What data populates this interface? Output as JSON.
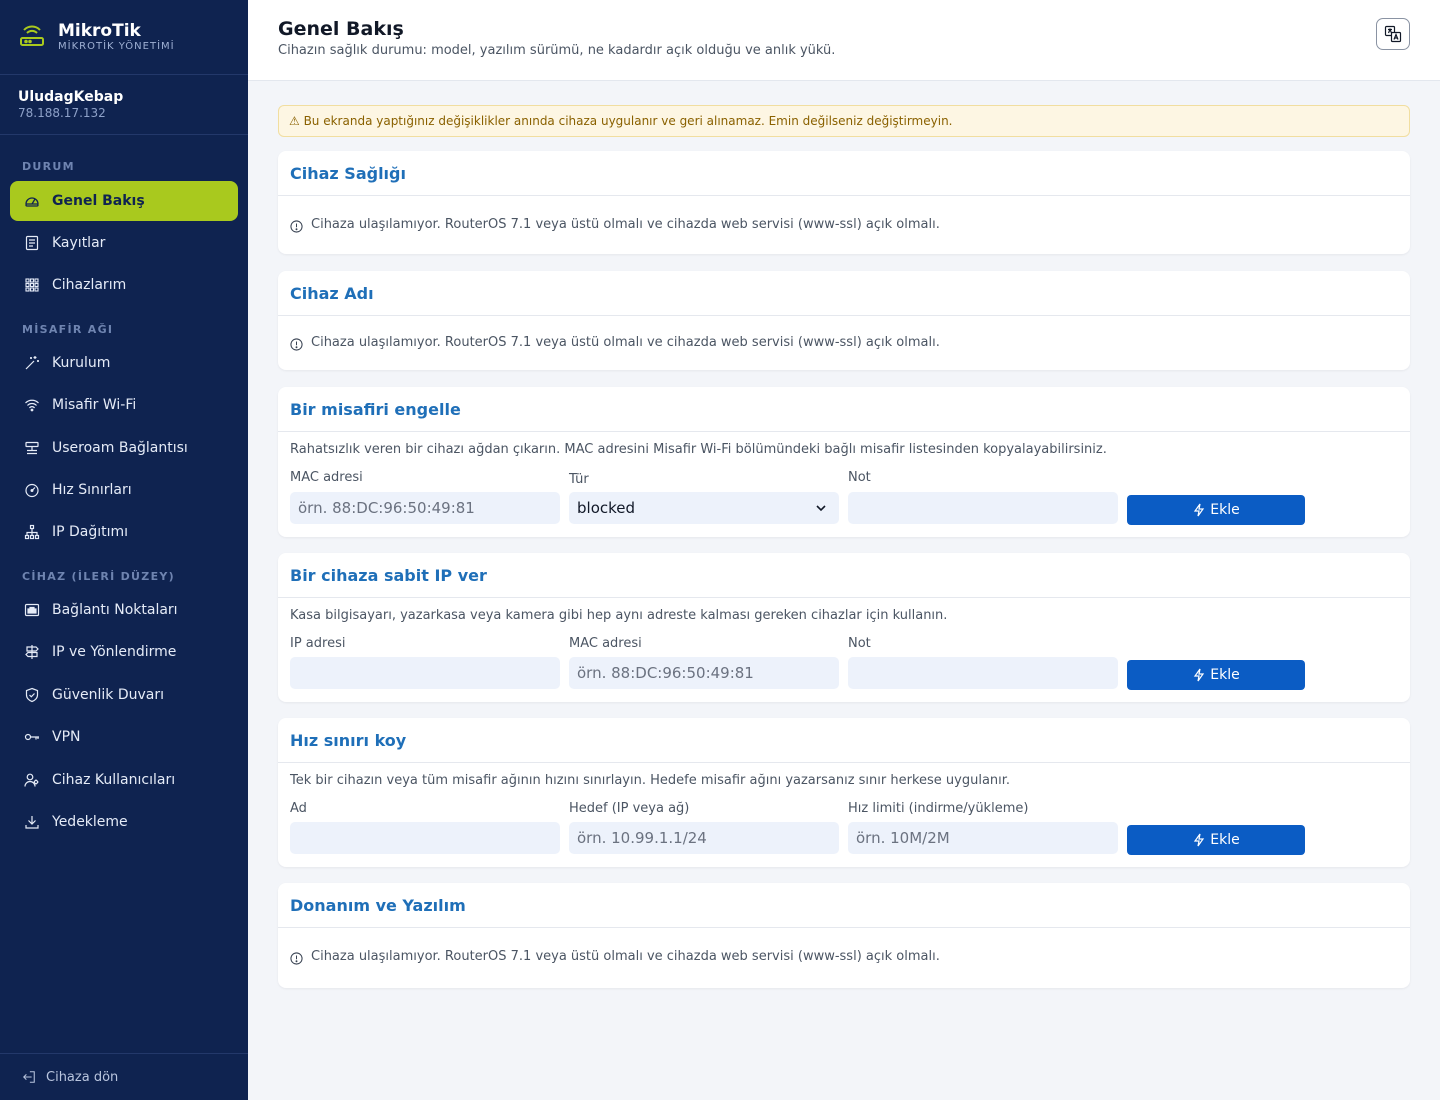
{
  "brand": {
    "title": "MikroTik",
    "subtitle": "MİKROTİK YÖNETİMİ"
  },
  "device": {
    "name": "UludagKebap",
    "ip": "78.188.17.132"
  },
  "sidebar": {
    "sections": [
      "DURUM",
      "MİSAFİR AĞI",
      "CİHAZ (İLERİ DÜZEY)"
    ],
    "items": [
      {
        "label": "Genel Bakış",
        "icon": "gauge-icon"
      },
      {
        "label": "Kayıtlar",
        "icon": "log-icon"
      },
      {
        "label": "Cihazlarım",
        "icon": "grid-icon"
      },
      {
        "label": "Kurulum",
        "icon": "wand-icon"
      },
      {
        "label": "Misafir Wi-Fi",
        "icon": "wifi-icon"
      },
      {
        "label": "Useroam Bağlantısı",
        "icon": "server-icon"
      },
      {
        "label": "Hız Sınırları",
        "icon": "speedometer-icon"
      },
      {
        "label": "IP Dağıtımı",
        "icon": "network-icon"
      },
      {
        "label": "Bağlantı Noktaları",
        "icon": "port-icon"
      },
      {
        "label": "IP ve Yönlendirme",
        "icon": "signpost-icon"
      },
      {
        "label": "Güvenlik Duvarı",
        "icon": "shield-icon"
      },
      {
        "label": "VPN",
        "icon": "key-icon"
      },
      {
        "label": "Cihaz Kullanıcıları",
        "icon": "users-icon"
      },
      {
        "label": "Yedekleme",
        "icon": "download-icon"
      }
    ],
    "footer": "Cihaza dön"
  },
  "header": {
    "title": "Genel Bakış",
    "subtitle": "Cihazın sağlık durumu: model, yazılım sürümü, ne kadardır açık olduğu ve anlık yükü."
  },
  "alert": "⚠ Bu ekranda yaptığınız değişiklikler anında cihaza uygulanır ve geri alınamaz. Emin değilseniz değiştirmeyin.",
  "unreachable": "Cihaza ulaşılamıyor. RouterOS 7.1 veya üstü olmalı ve cihazda web servisi (www-ssl) açık olmalı.",
  "cards": {
    "health": {
      "title": "Cihaz Sağlığı"
    },
    "name": {
      "title": "Cihaz Adı"
    },
    "block": {
      "title": "Bir misafiri engelle",
      "desc": "Rahatsızlık veren bir cihazı ağdan çıkarın. MAC adresini Misafir Wi-Fi bölümündeki bağlı misafir listesinden kopyalayabilirsiniz.",
      "mac_label": "MAC adresi",
      "mac_placeholder": "örn. 88:DC:96:50:49:81",
      "type_label": "Tür",
      "type_value": "blocked",
      "note_label": "Not",
      "button": "Ekle"
    },
    "static": {
      "title": "Bir cihaza sabit IP ver",
      "desc": "Kasa bilgisayarı, yazarkasa veya kamera gibi hep aynı adreste kalması gereken cihazlar için kullanın.",
      "ip_label": "IP adresi",
      "mac_label": "MAC adresi",
      "mac_placeholder": "örn. 88:DC:96:50:49:81",
      "note_label": "Not",
      "button": "Ekle"
    },
    "limit": {
      "title": "Hız sınırı koy",
      "desc": "Tek bir cihazın veya tüm misafir ağının hızını sınırlayın. Hedefe misafir ağını yazarsanız sınır herkese uygulanır.",
      "name_label": "Ad",
      "target_label": "Hedef (IP veya ağ)",
      "target_placeholder": "örn. 10.99.1.1/24",
      "rate_label": "Hız limiti (indirme/yükleme)",
      "rate_placeholder": "örn. 10M/2M",
      "button": "Ekle"
    },
    "hw": {
      "title": "Donanım ve Yazılım"
    }
  },
  "colors": {
    "sidebar": "#0f2350",
    "accent": "#a9c91e",
    "primary": "#0b5cc4",
    "heading": "#1f6fb8"
  }
}
